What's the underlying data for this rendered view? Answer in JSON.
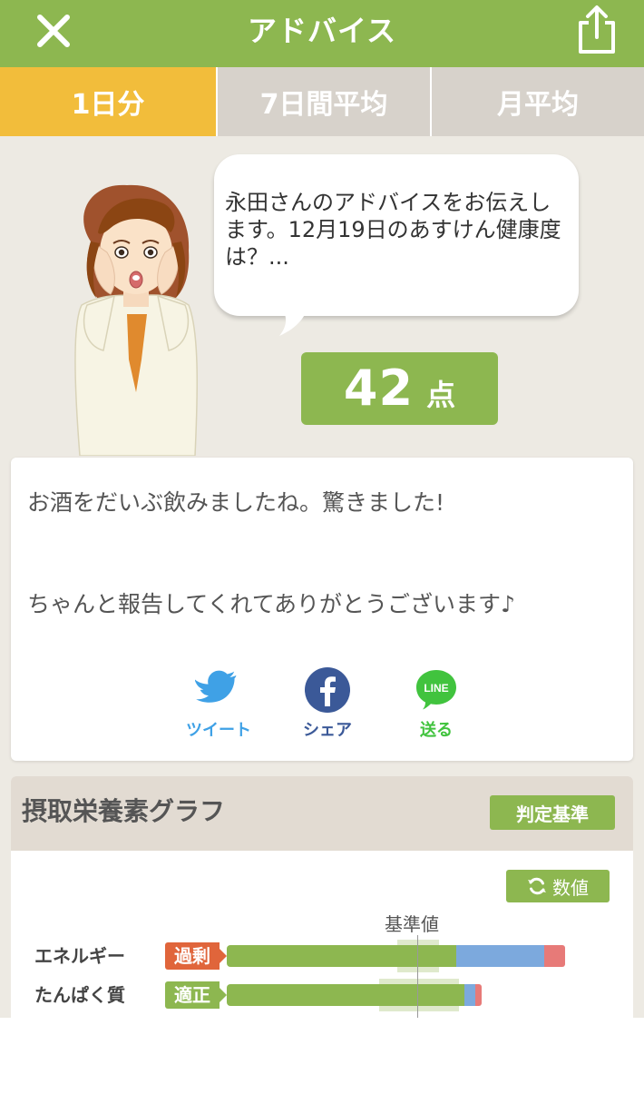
{
  "header": {
    "title": "アドバイス",
    "close_icon": "close-icon",
    "share_icon": "share-icon"
  },
  "tabs": [
    {
      "label": "1日分",
      "active": true
    },
    {
      "label": "7日間平均",
      "active": false
    },
    {
      "label": "月平均",
      "active": false
    }
  ],
  "advice": {
    "bubble_text": "永田さんのアドバイスをお伝えします。12月19日のあすけん健康度は？...",
    "score": "42",
    "score_unit": "点"
  },
  "message": {
    "line1": "お酒をだいぶ飲みましたね。驚きました!",
    "line2": "ちゃんと報告してくれてありがとうございます♪"
  },
  "share": {
    "twitter_label": "ツイート",
    "facebook_label": "シェア",
    "line_label": "送る",
    "line_logo_text": "LINE"
  },
  "graph": {
    "title": "摂取栄養素グラフ",
    "criteria_label": "判定基準",
    "value_label": "数値",
    "baseline_label": "基準値",
    "nutrients": [
      {
        "name": "エネルギー",
        "status": "過剰",
        "status_color": "#e0653b",
        "green": 0.55,
        "blue": 0.21,
        "red": 0.05
      },
      {
        "name": "たんぱく質",
        "status": "適正",
        "status_color": "#8db750",
        "green": 0.57,
        "blue": 0.025,
        "red": 0.015
      }
    ]
  },
  "colors": {
    "accent": "#8db750",
    "tab_active": "#f2bd3b",
    "tab_inactive": "#d7d2cb",
    "background": "#edeae3"
  }
}
